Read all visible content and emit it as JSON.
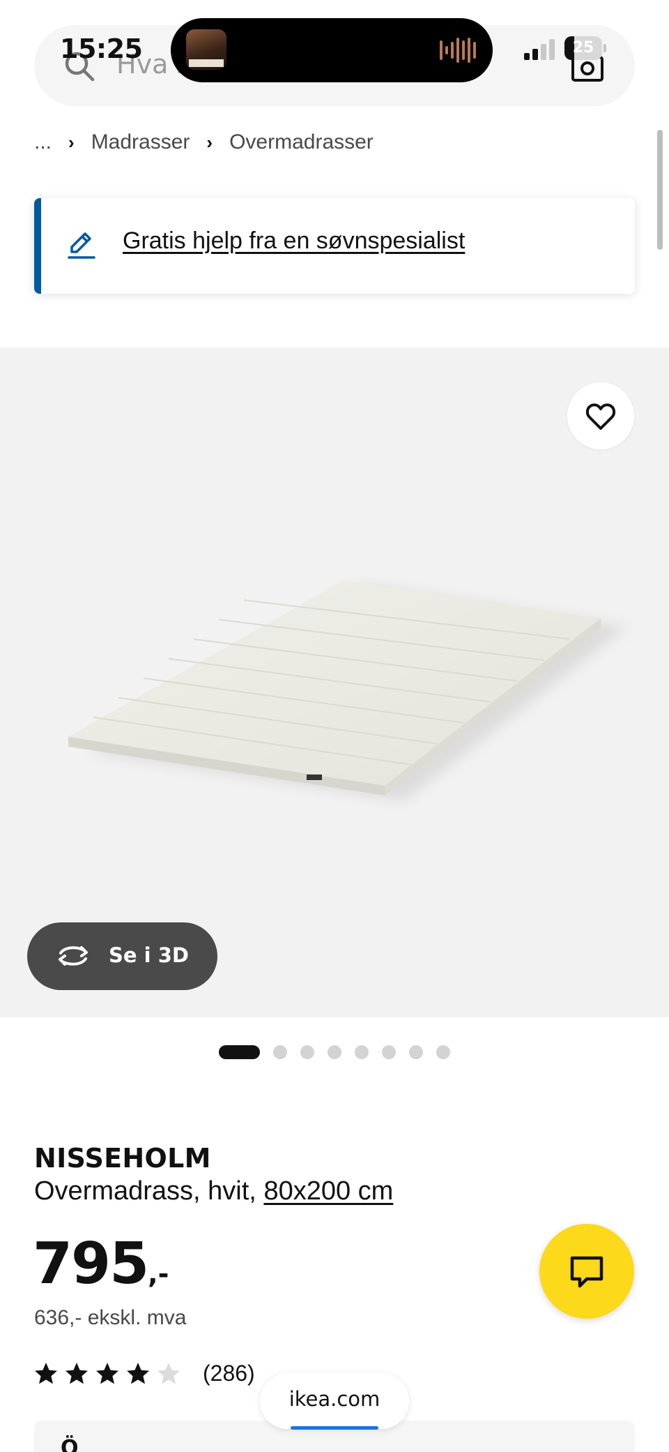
{
  "status_bar": {
    "time": "15:25",
    "battery_level": "25",
    "battery_fraction": 0.25
  },
  "search": {
    "placeholder": "Hva s"
  },
  "breadcrumb": {
    "ellipsis": "...",
    "items": [
      "Madrasser",
      "Overmadrasser"
    ]
  },
  "banner": {
    "link_text": "Gratis hjelp fra en søvnspesialist"
  },
  "gallery": {
    "view_3d_label": "Se i 3D",
    "dot_count": 8,
    "active_dot": 0
  },
  "product": {
    "name": "NISSEHOLM",
    "description": "Overmadrass, hvit,",
    "size": "80x200 cm",
    "price": "795",
    "price_suffix": ",-",
    "price_ex_vat": "636,- ekskl. mva",
    "rating_stars": 4,
    "rating_max": 5,
    "review_count": "(286)"
  },
  "browser": {
    "url": "ikea.com"
  },
  "bottom_card": {
    "text": "Ö"
  },
  "colors": {
    "accent_blue": "#0058a3",
    "chat_yellow": "#fcd91a",
    "image_background": "#f2f2f2"
  },
  "icons": [
    "search-icon",
    "camera-icon",
    "pencil-icon",
    "heart-icon",
    "rotate-3d-icon",
    "chat-icon",
    "star-icon",
    "chevron-right-icon"
  ]
}
